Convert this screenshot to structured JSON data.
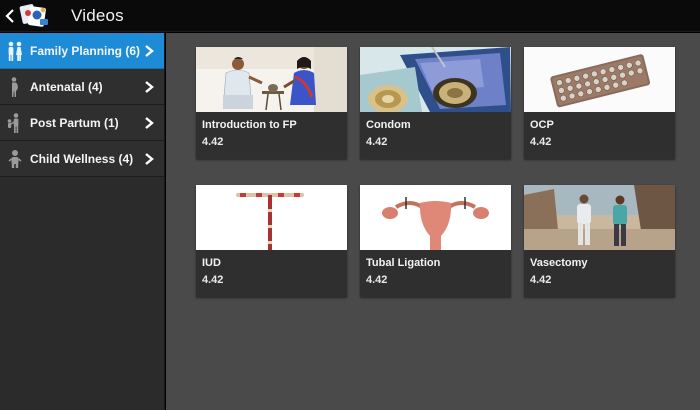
{
  "header": {
    "title": "Videos"
  },
  "sidebar": {
    "items": [
      {
        "label": "Family Planning (6)",
        "icon": "couple-icon",
        "active": true
      },
      {
        "label": "Antenatal (4)",
        "icon": "pregnant-woman-icon",
        "active": false
      },
      {
        "label": "Post Partum (1)",
        "icon": "mother-child-icon",
        "active": false
      },
      {
        "label": "Child Wellness (4)",
        "icon": "child-icon",
        "active": false
      }
    ]
  },
  "videos": [
    {
      "title": "Introduction to FP",
      "duration": "4.42",
      "thumbnail": "counselling-scene"
    },
    {
      "title": "Condom",
      "duration": "4.42",
      "thumbnail": "condom-packets"
    },
    {
      "title": "OCP",
      "duration": "4.42",
      "thumbnail": "pill-strip"
    },
    {
      "title": "IUD",
      "duration": "4.42",
      "thumbnail": "iud-device"
    },
    {
      "title": "Tubal Ligation",
      "duration": "4.42",
      "thumbnail": "uterus-diagram"
    },
    {
      "title": "Vasectomy",
      "duration": "4.42",
      "thumbnail": "village-men"
    }
  ],
  "colors": {
    "accent": "#1d8bd6",
    "sidebar": "#2f2f2f",
    "content": "#4a4a4a",
    "topbar": "#0a0a0a"
  }
}
